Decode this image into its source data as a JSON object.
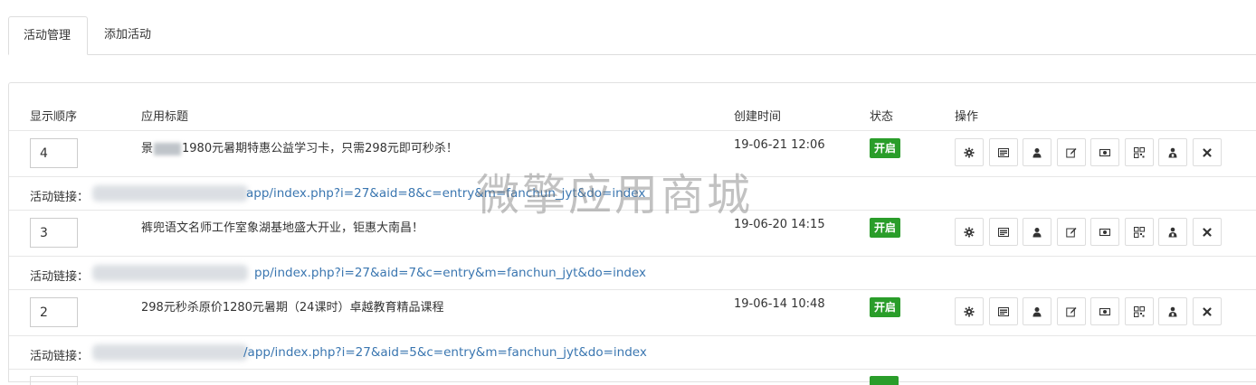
{
  "tabs": [
    {
      "label": "活动管理",
      "active": true
    },
    {
      "label": "添加活动",
      "active": false
    }
  ],
  "table": {
    "headers": {
      "order": "显示顺序",
      "title": "应用标题",
      "created": "创建时间",
      "status": "状态",
      "actions": "操作"
    },
    "rows": [
      {
        "order": "4",
        "title_prefix": "景",
        "title_suffix": "1980元暑期特惠公益学习卡，只需298元即可秒杀！",
        "created": "19-06-21 12:06",
        "status": "开启",
        "link_label": "活动链接：",
        "link_url": "app/index.php?i=27&aid=8&c=entry&m=fanchun_jyt&do=index"
      },
      {
        "order": "3",
        "title": "裤兜语文名师工作室象湖基地盛大开业，钜惠大南昌！",
        "created": "19-06-20 14:15",
        "status": "开启",
        "link_label": "活动链接：",
        "link_url": "pp/index.php?i=27&aid=7&c=entry&m=fanchun_jyt&do=index"
      },
      {
        "order": "2",
        "title": "298元秒杀原价1280元暑期（24课时）卓越教育精品课程",
        "created": "19-06-14 10:48",
        "status": "开启",
        "link_label": "活动链接：",
        "link_url": "/app/index.php?i=27&aid=5&c=entry&m=fanchun_jyt&do=index"
      }
    ],
    "action_icons": [
      "gear-icon",
      "list-icon",
      "user-icon",
      "edit-icon",
      "money-icon",
      "qrcode-icon",
      "user-badge-icon",
      "close-icon"
    ]
  },
  "watermark": "微擎应用商城",
  "colors": {
    "status_on": "#2a9d2a",
    "link": "#3a76b0"
  }
}
